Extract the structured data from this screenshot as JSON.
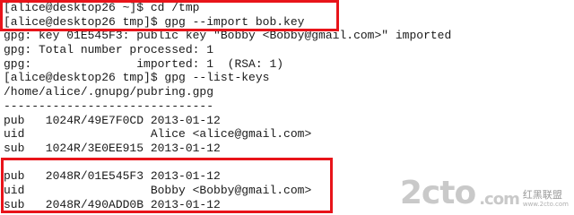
{
  "terminal": {
    "lines": [
      "[alice@desktop26 ~]$ cd /tmp",
      "[alice@desktop26 tmp]$ gpg --import bob.key",
      "gpg: key 01E545F3: public key \"Bobby <Bobby@gmail.com>\" imported",
      "gpg: Total number processed: 1",
      "gpg:               imported: 1  (RSA: 1)",
      "[alice@desktop26 tmp]$ gpg --list-keys",
      "/home/alice/.gnupg/pubring.gpg",
      "------------------------------",
      "pub   1024R/49E7F0CD 2013-01-12",
      "uid                  Alice <alice@gmail.com>",
      "sub   1024R/3E0EE915 2013-01-12",
      "",
      "pub   2048R/01E545F3 2013-01-12",
      "uid                  Bobby <Bobby@gmail.com>",
      "sub   2048R/490ADD0B 2013-01-12"
    ]
  },
  "watermark": {
    "logo": "2cto",
    "tld": ".com",
    "cn": "红黑联盟",
    "url": "www.2cto.com"
  },
  "colors": {
    "highlight": "#e8141a",
    "text": "#1a1a1a"
  }
}
